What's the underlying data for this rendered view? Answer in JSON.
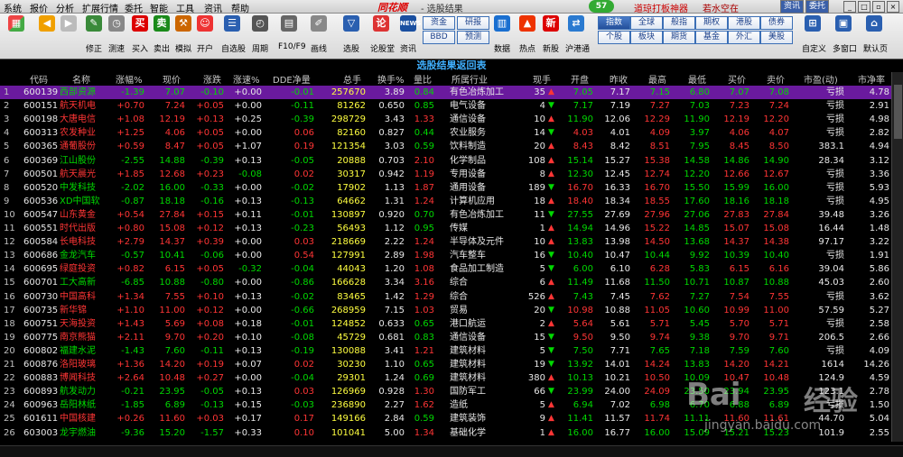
{
  "menu": {
    "items": [
      "系统",
      "报价",
      "分析",
      "扩展行情",
      "委托",
      "智能",
      "工具",
      "资讯",
      "帮助"
    ],
    "logo": "同花顺",
    "window_title": "- 选股结果",
    "status_number": "57",
    "promo": "道琼打板神器",
    "promo2": "若水空在",
    "right_buttons": [
      "资讯",
      "委托"
    ]
  },
  "toolbar": {
    "buttons": [
      "修正",
      "测速",
      "买入",
      "卖出",
      "模拟",
      "开户",
      "自选股",
      "周期",
      "F10/F9",
      "画线",
      "选股",
      "论股堂",
      "资讯",
      "数据",
      "热点",
      "新股",
      "沪港通",
      "自定义",
      "多窗口",
      "默认页"
    ],
    "mini_left": [
      "资金",
      "研报",
      "BBD",
      "预测"
    ],
    "mini_right": [
      "指数",
      "全球",
      "般指",
      "期权",
      "港股",
      "债券",
      "个股",
      "板块",
      "期货",
      "基金",
      "外汇",
      "美股"
    ]
  },
  "table": {
    "title": "选股结果返回表",
    "columns": [
      "代码",
      "名称",
      "涨幅%",
      "现价",
      "涨跌",
      "涨速%",
      "DDE净量",
      "总手",
      "换手%",
      "量比",
      "所属行业",
      "现手",
      "开盘",
      "昨收",
      "最高",
      "最低",
      "买价",
      "卖价",
      "市盈(动)",
      "市净率"
    ],
    "rows": [
      {
        "i": "1",
        "code": "600139",
        "name": "西部资源",
        "chg": "-1.39",
        "price": "7.07",
        "diff": "-0.10",
        "spd": "+0.00",
        "dde": "-0.01",
        "vol": "257670",
        "turn": "3.89",
        "vr": "0.84",
        "ind": "有色冶炼加工",
        "hand": "35",
        "dir": "up",
        "open": "7.05",
        "prev": "7.17",
        "high": "7.15",
        "low": "6.80",
        "bid": "7.07",
        "ask": "7.08",
        "pe": "亏损",
        "pb": "4.78"
      },
      {
        "i": "2",
        "code": "600151",
        "name": "航天机电",
        "chg": "+0.70",
        "price": "7.24",
        "diff": "+0.05",
        "spd": "+0.00",
        "dde": "-0.11",
        "vol": "81262",
        "turn": "0.650",
        "vr": "0.85",
        "ind": "电气设备",
        "hand": "4",
        "dir": "dn",
        "open": "7.17",
        "prev": "7.19",
        "high": "7.27",
        "low": "7.03",
        "bid": "7.23",
        "ask": "7.24",
        "pe": "亏损",
        "pb": "2.91"
      },
      {
        "i": "3",
        "code": "600198",
        "name": "大唐电信",
        "chg": "+1.08",
        "price": "12.19",
        "diff": "+0.13",
        "spd": "+0.25",
        "dde": "-0.39",
        "vol": "298729",
        "turn": "3.43",
        "vr": "1.33",
        "ind": "通信设备",
        "hand": "10",
        "dir": "up",
        "open": "11.90",
        "prev": "12.06",
        "high": "12.29",
        "low": "11.90",
        "bid": "12.19",
        "ask": "12.20",
        "pe": "亏损",
        "pb": "4.98"
      },
      {
        "i": "4",
        "code": "600313",
        "name": "农发种业",
        "chg": "+1.25",
        "price": "4.06",
        "diff": "+0.05",
        "spd": "+0.00",
        "dde": "0.06",
        "vol": "82160",
        "turn": "0.827",
        "vr": "0.44",
        "ind": "农业服务",
        "hand": "14",
        "dir": "dn",
        "open": "4.03",
        "prev": "4.01",
        "high": "4.09",
        "low": "3.97",
        "bid": "4.06",
        "ask": "4.07",
        "pe": "亏损",
        "pb": "2.82"
      },
      {
        "i": "5",
        "code": "600365",
        "name": "通葡股份",
        "chg": "+0.59",
        "price": "8.47",
        "diff": "+0.05",
        "spd": "+1.07",
        "dde": "0.19",
        "vol": "121354",
        "turn": "3.03",
        "vr": "0.59",
        "ind": "饮料制造",
        "hand": "20",
        "dir": "up",
        "open": "8.43",
        "prev": "8.42",
        "high": "8.51",
        "low": "7.95",
        "bid": "8.45",
        "ask": "8.50",
        "pe": "383.1",
        "pb": "4.94"
      },
      {
        "i": "6",
        "code": "600369",
        "name": "江山股份",
        "chg": "-2.55",
        "price": "14.88",
        "diff": "-0.39",
        "spd": "+0.13",
        "dde": "-0.05",
        "vol": "20888",
        "turn": "0.703",
        "vr": "2.10",
        "ind": "化学制品",
        "hand": "108",
        "dir": "up",
        "open": "15.14",
        "prev": "15.27",
        "high": "15.38",
        "low": "14.58",
        "bid": "14.86",
        "ask": "14.90",
        "pe": "28.34",
        "pb": "3.12"
      },
      {
        "i": "7",
        "code": "600501",
        "name": "航天晨光",
        "chg": "+1.85",
        "price": "12.68",
        "diff": "+0.23",
        "spd": "-0.08",
        "dde": "0.02",
        "vol": "30317",
        "turn": "0.942",
        "vr": "1.19",
        "ind": "专用设备",
        "hand": "8",
        "dir": "up",
        "open": "12.30",
        "prev": "12.45",
        "high": "12.74",
        "low": "12.20",
        "bid": "12.66",
        "ask": "12.67",
        "pe": "亏损",
        "pb": "3.36"
      },
      {
        "i": "8",
        "code": "600520",
        "name": "中发科技",
        "chg": "-2.02",
        "price": "16.00",
        "diff": "-0.33",
        "spd": "+0.00",
        "dde": "-0.02",
        "vol": "17902",
        "turn": "1.13",
        "vr": "1.87",
        "ind": "通用设备",
        "hand": "189",
        "dir": "dn",
        "open": "16.70",
        "prev": "16.33",
        "high": "16.70",
        "low": "15.50",
        "bid": "15.99",
        "ask": "16.00",
        "pe": "亏损",
        "pb": "5.93"
      },
      {
        "i": "9",
        "code": "600536",
        "name": "XD中国软",
        "chg": "-0.87",
        "price": "18.18",
        "diff": "-0.16",
        "spd": "+0.13",
        "dde": "-0.13",
        "vol": "64662",
        "turn": "1.31",
        "vr": "1.24",
        "ind": "计算机应用",
        "hand": "18",
        "dir": "up",
        "open": "18.40",
        "prev": "18.34",
        "high": "18.55",
        "low": "17.60",
        "bid": "18.16",
        "ask": "18.18",
        "pe": "亏损",
        "pb": "4.95"
      },
      {
        "i": "10",
        "code": "600547",
        "name": "山东黄金",
        "chg": "+0.54",
        "price": "27.84",
        "diff": "+0.15",
        "spd": "+0.11",
        "dde": "-0.01",
        "vol": "130897",
        "turn": "0.920",
        "vr": "0.70",
        "ind": "有色冶炼加工",
        "hand": "11",
        "dir": "dn",
        "open": "27.55",
        "prev": "27.69",
        "high": "27.96",
        "low": "27.06",
        "bid": "27.83",
        "ask": "27.84",
        "pe": "39.48",
        "pb": "3.26"
      },
      {
        "i": "11",
        "code": "600551",
        "name": "时代出版",
        "chg": "+0.80",
        "price": "15.08",
        "diff": "+0.12",
        "spd": "+0.13",
        "dde": "-0.23",
        "vol": "56493",
        "turn": "1.12",
        "vr": "0.95",
        "ind": "传媒",
        "hand": "1",
        "dir": "up",
        "open": "14.94",
        "prev": "14.96",
        "high": "15.22",
        "low": "14.85",
        "bid": "15.07",
        "ask": "15.08",
        "pe": "16.44",
        "pb": "1.48"
      },
      {
        "i": "12",
        "code": "600584",
        "name": "长电科技",
        "chg": "+2.79",
        "price": "14.37",
        "diff": "+0.39",
        "spd": "+0.00",
        "dde": "0.03",
        "vol": "218669",
        "turn": "2.22",
        "vr": "1.24",
        "ind": "半导体及元件",
        "hand": "10",
        "dir": "up",
        "open": "13.83",
        "prev": "13.98",
        "high": "14.50",
        "low": "13.68",
        "bid": "14.37",
        "ask": "14.38",
        "pe": "97.17",
        "pb": "3.22"
      },
      {
        "i": "13",
        "code": "600686",
        "name": "金龙汽车",
        "chg": "-0.57",
        "price": "10.41",
        "diff": "-0.06",
        "spd": "+0.00",
        "dde": "0.54",
        "vol": "127991",
        "turn": "2.89",
        "vr": "1.98",
        "ind": "汽车整车",
        "hand": "16",
        "dir": "dn",
        "open": "10.40",
        "prev": "10.47",
        "high": "10.44",
        "low": "9.92",
        "bid": "10.39",
        "ask": "10.40",
        "pe": "亏损",
        "pb": "1.91"
      },
      {
        "i": "14",
        "code": "600695",
        "name": "绿庭投资",
        "chg": "+0.82",
        "price": "6.15",
        "diff": "+0.05",
        "spd": "-0.32",
        "dde": "-0.04",
        "vol": "44043",
        "turn": "1.20",
        "vr": "1.08",
        "ind": "食品加工制造",
        "hand": "5",
        "dir": "dn",
        "open": "6.00",
        "prev": "6.10",
        "high": "6.28",
        "low": "5.83",
        "bid": "6.15",
        "ask": "6.16",
        "pe": "39.04",
        "pb": "5.86"
      },
      {
        "i": "15",
        "code": "600701",
        "name": "工大高新",
        "chg": "-6.85",
        "price": "10.88",
        "diff": "-0.80",
        "spd": "+0.00",
        "dde": "-0.86",
        "vol": "166628",
        "turn": "3.34",
        "vr": "3.16",
        "ind": "综合",
        "hand": "6",
        "dir": "up",
        "open": "11.49",
        "prev": "11.68",
        "high": "11.50",
        "low": "10.71",
        "bid": "10.87",
        "ask": "10.88",
        "pe": "45.03",
        "pb": "2.60"
      },
      {
        "i": "16",
        "code": "600730",
        "name": "中国高科",
        "chg": "+1.34",
        "price": "7.55",
        "diff": "+0.10",
        "spd": "+0.13",
        "dde": "-0.02",
        "vol": "83465",
        "turn": "1.42",
        "vr": "1.29",
        "ind": "综合",
        "hand": "526",
        "dir": "up",
        "open": "7.43",
        "prev": "7.45",
        "high": "7.62",
        "low": "7.27",
        "bid": "7.54",
        "ask": "7.55",
        "pe": "亏损",
        "pb": "3.62"
      },
      {
        "i": "17",
        "code": "600735",
        "name": "新华锦",
        "chg": "+1.10",
        "price": "11.00",
        "diff": "+0.12",
        "spd": "+0.00",
        "dde": "-0.66",
        "vol": "268959",
        "turn": "7.15",
        "vr": "1.03",
        "ind": "贸易",
        "hand": "20",
        "dir": "dn",
        "open": "10.98",
        "prev": "10.88",
        "high": "11.05",
        "low": "10.60",
        "bid": "10.99",
        "ask": "11.00",
        "pe": "57.59",
        "pb": "5.27"
      },
      {
        "i": "18",
        "code": "600751",
        "name": "天海投资",
        "chg": "+1.43",
        "price": "5.69",
        "diff": "+0.08",
        "spd": "+0.18",
        "dde": "-0.01",
        "vol": "124852",
        "turn": "0.633",
        "vr": "0.65",
        "ind": "港口航运",
        "hand": "2",
        "dir": "up",
        "open": "5.64",
        "prev": "5.61",
        "high": "5.71",
        "low": "5.45",
        "bid": "5.70",
        "ask": "5.71",
        "pe": "亏损",
        "pb": "2.58"
      },
      {
        "i": "19",
        "code": "600775",
        "name": "南京熊猫",
        "chg": "+2.11",
        "price": "9.70",
        "diff": "+0.20",
        "spd": "+0.10",
        "dde": "-0.08",
        "vol": "45729",
        "turn": "0.681",
        "vr": "0.83",
        "ind": "通信设备",
        "hand": "15",
        "dir": "dn",
        "open": "9.50",
        "prev": "9.50",
        "high": "9.74",
        "low": "9.38",
        "bid": "9.70",
        "ask": "9.71",
        "pe": "206.5",
        "pb": "2.66"
      },
      {
        "i": "20",
        "code": "600802",
        "name": "福建水泥",
        "chg": "-1.43",
        "price": "7.60",
        "diff": "-0.11",
        "spd": "+0.13",
        "dde": "-0.19",
        "vol": "130088",
        "turn": "3.41",
        "vr": "1.21",
        "ind": "建筑材料",
        "hand": "5",
        "dir": "dn",
        "open": "7.50",
        "prev": "7.71",
        "high": "7.65",
        "low": "7.18",
        "bid": "7.59",
        "ask": "7.60",
        "pe": "亏损",
        "pb": "4.09"
      },
      {
        "i": "21",
        "code": "600876",
        "name": "洛阳玻璃",
        "chg": "+1.36",
        "price": "14.20",
        "diff": "+0.19",
        "spd": "+0.07",
        "dde": "0.02",
        "vol": "30230",
        "turn": "1.10",
        "vr": "0.65",
        "ind": "建筑材料",
        "hand": "19",
        "dir": "dn",
        "open": "13.92",
        "prev": "14.01",
        "high": "14.24",
        "low": "13.83",
        "bid": "14.20",
        "ask": "14.21",
        "pe": "1614",
        "pb": "14.26"
      },
      {
        "i": "22",
        "code": "600883",
        "name": "博闻科技",
        "chg": "+2.64",
        "price": "10.48",
        "diff": "+0.27",
        "spd": "+0.00",
        "dde": "-0.04",
        "vol": "29301",
        "turn": "1.24",
        "vr": "0.69",
        "ind": "建筑材料",
        "hand": "380",
        "dir": "up",
        "open": "10.13",
        "prev": "10.21",
        "high": "10.50",
        "low": "10.09",
        "bid": "10.47",
        "ask": "10.48",
        "pe": "124.9",
        "pb": "4.59"
      },
      {
        "i": "23",
        "code": "600893",
        "name": "航发动力",
        "chg": "-0.21",
        "price": "23.95",
        "diff": "-0.05",
        "spd": "+0.13",
        "dde": "0.03",
        "vol": "126969",
        "turn": "0.928",
        "vr": "1.30",
        "ind": "国防军工",
        "hand": "66",
        "dir": "dn",
        "open": "23.99",
        "prev": "24.00",
        "high": "24.09",
        "low": "23.50",
        "bid": "23.94",
        "ask": "23.95",
        "pe": "123.1",
        "pb": "2.78"
      },
      {
        "i": "24",
        "code": "600963",
        "name": "岳阳林纸",
        "chg": "-1.85",
        "price": "6.89",
        "diff": "-0.13",
        "spd": "+0.15",
        "dde": "-0.03",
        "vol": "236890",
        "turn": "2.27",
        "vr": "1.62",
        "ind": "造纸",
        "hand": "5",
        "dir": "up",
        "open": "6.94",
        "prev": "7.02",
        "high": "6.98",
        "low": "6.70",
        "bid": "6.88",
        "ask": "6.89",
        "pe": "亏损",
        "pb": "1.50"
      },
      {
        "i": "25",
        "code": "601611",
        "name": "中国核建",
        "chg": "+0.26",
        "price": "11.60",
        "diff": "+0.03",
        "spd": "+0.17",
        "dde": "0.17",
        "vol": "149166",
        "turn": "2.84",
        "vr": "0.59",
        "ind": "建筑装饰",
        "hand": "9",
        "dir": "up",
        "open": "11.41",
        "prev": "11.57",
        "high": "11.74",
        "low": "11.11",
        "bid": "11.60",
        "ask": "11.61",
        "pe": "44.70",
        "pb": "5.04"
      },
      {
        "i": "26",
        "code": "603003",
        "name": "龙宇燃油",
        "chg": "-9.36",
        "price": "15.20",
        "diff": "-1.57",
        "spd": "+0.33",
        "dde": "0.10",
        "vol": "101041",
        "turn": "5.00",
        "vr": "1.34",
        "ind": "基础化学",
        "hand": "1",
        "dir": "up",
        "open": "16.00",
        "prev": "16.77",
        "high": "16.00",
        "low": "15.09",
        "bid": "15.21",
        "ask": "15.23",
        "pe": "101.9",
        "pb": "2.55"
      }
    ]
  },
  "watermark": {
    "brand": "Bai",
    "brand2": "经验",
    "url": "jingyan.baidu.com"
  },
  "colors": {
    "up": "#ff3535",
    "down": "#00d800",
    "selected": "#6a1a9e",
    "title": "#40b0ff"
  }
}
